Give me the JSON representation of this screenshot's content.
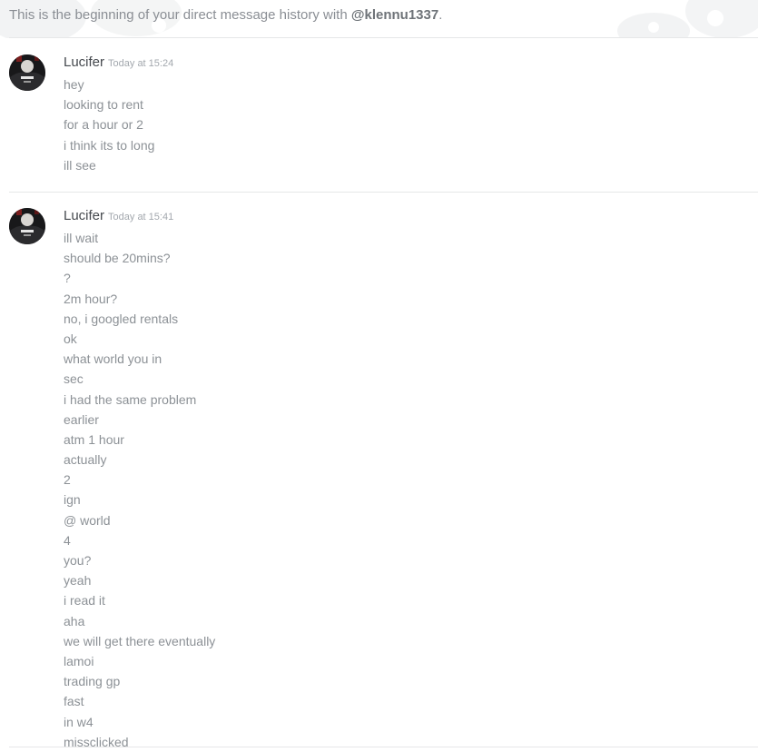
{
  "header": {
    "intro_prefix": "This is the beginning of your direct message history with ",
    "intro_user": "@klennu1337",
    "intro_suffix": "."
  },
  "messages": [
    {
      "author": "Lucifer",
      "timestamp": "Today at 15:24",
      "lines": [
        "hey",
        "looking to rent",
        "for a hour or 2",
        "i think its to long",
        "ill see"
      ]
    },
    {
      "author": "Lucifer",
      "timestamp": "Today at 15:41",
      "lines": [
        "ill wait",
        "should be 20mins?",
        "?",
        "2m hour?",
        "no, i googled rentals",
        "ok",
        "what world you in",
        "sec",
        "i had the same problem",
        "earlier",
        "atm 1 hour",
        "actually",
        "2",
        "ign",
        "@ world",
        "4",
        "you?",
        "yeah",
        "i read it",
        "aha",
        "we will get there eventually",
        "lamoi",
        "trading gp",
        "fast",
        "in w4",
        "missclicked"
      ]
    }
  ],
  "colors": {
    "username": "#45494e",
    "message_text": "#8c9196",
    "timestamp": "#a3a8ae",
    "divider": "#e6e7e8"
  }
}
